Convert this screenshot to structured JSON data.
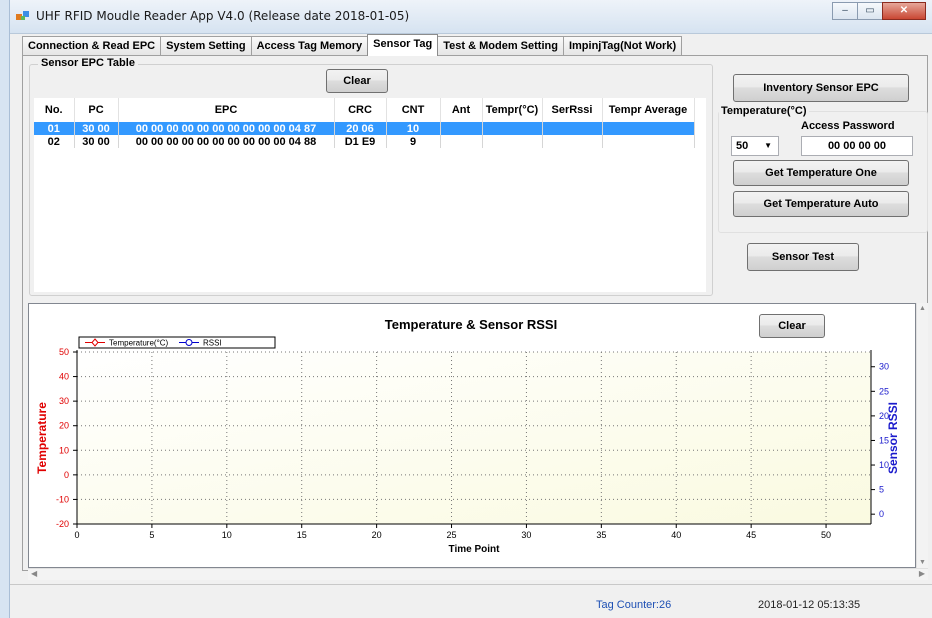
{
  "window": {
    "title": "UHF RFID Moudle Reader App V4.0 (Release date 2018-01-05)"
  },
  "tabs": [
    {
      "label": "Connection & Read EPC"
    },
    {
      "label": "System Setting"
    },
    {
      "label": "Access Tag Memory"
    },
    {
      "label": "Sensor Tag",
      "active": true
    },
    {
      "label": "Test & Modem Setting"
    },
    {
      "label": "ImpinjTag(Not Work)"
    }
  ],
  "sensor_table": {
    "group_label": "Sensor EPC Table",
    "clear_label": "Clear",
    "columns": [
      "No.",
      "PC",
      "EPC",
      "CRC",
      "CNT",
      "Ant",
      "Tempr(°C)",
      "SerRssi",
      "Tempr Average"
    ],
    "rows": [
      [
        "01",
        "30 00",
        "00 00 00 00 00 00 00 00 00 00 04 87",
        "20 06",
        "10",
        "",
        "",
        "",
        ""
      ],
      [
        "02",
        "30 00",
        "00 00 00 00 00 00 00 00 00 00 04 88",
        "D1 E9",
        "9",
        "",
        "",
        "",
        ""
      ]
    ],
    "selected_row": 0
  },
  "controls": {
    "inventory_label": "Inventory Sensor EPC",
    "temperature_group": "Temperature(°C)",
    "access_password_label": "Access Password",
    "password_value": "00 00 00 00",
    "select_value": "50",
    "get_one_label": "Get Temperature One",
    "get_auto_label": "Get Temperature Auto",
    "sensor_test_label": "Sensor Test"
  },
  "chart_clear_label": "Clear",
  "chart_data": {
    "type": "line",
    "title": "Temperature & Sensor RSSI",
    "xlabel": "Time Point",
    "ylabel": "Temperature",
    "y2label": "Sensor RSSI",
    "xlim": [
      0,
      53
    ],
    "ylim": [
      -20,
      50
    ],
    "y2lim": [
      -2,
      33
    ],
    "x_ticks": [
      0,
      5,
      10,
      15,
      20,
      25,
      30,
      35,
      40,
      45,
      50
    ],
    "y_ticks": [
      -20,
      -10,
      0,
      10,
      20,
      30,
      40,
      50
    ],
    "y2_ticks": [
      0,
      5,
      10,
      15,
      20,
      25,
      30
    ],
    "grid": true,
    "legend": "top-left",
    "series": [
      {
        "name": "Temperature(°C)",
        "color": "#e00000",
        "values": []
      },
      {
        "name": "RSSI",
        "color": "#0000cc",
        "values": []
      }
    ]
  },
  "status": {
    "tag_counter": "Tag Counter:26",
    "datetime": "2018-01-12 05:13:35"
  },
  "colors": {
    "selection": "#3399ff",
    "temperature_axis": "#e00000",
    "rssi_axis": "#1a1acc",
    "plot_bg": "#fafae0"
  }
}
